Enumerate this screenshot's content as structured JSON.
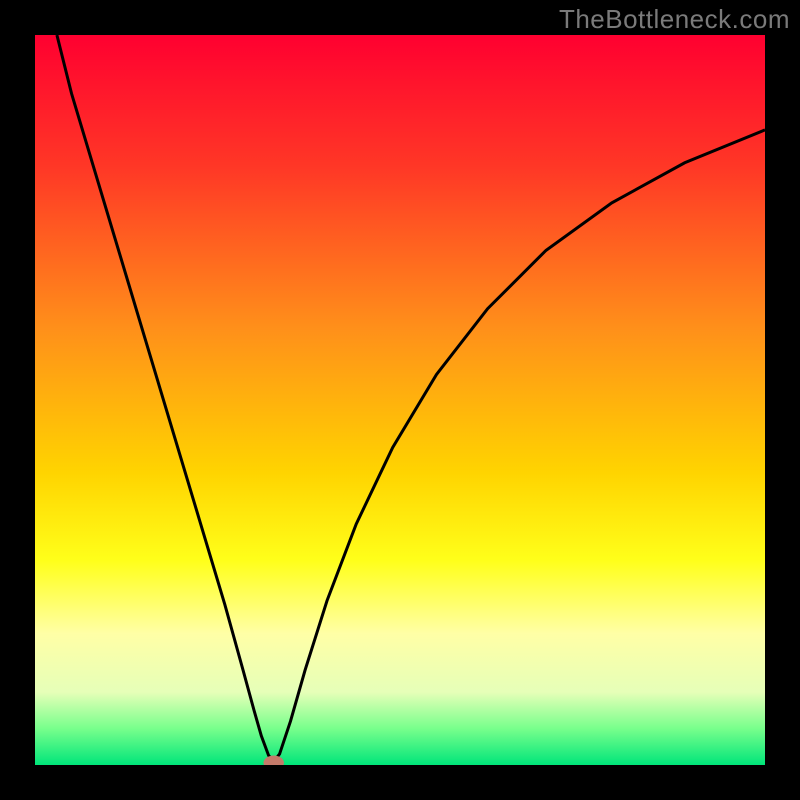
{
  "watermark": "TheBottleneck.com",
  "chart_data": {
    "type": "line",
    "title": "",
    "xlabel": "",
    "ylabel": "",
    "xlim": [
      0,
      1
    ],
    "ylim": [
      0,
      1
    ],
    "background_gradient": {
      "stops": [
        {
          "offset": 0.0,
          "color": "#ff0030"
        },
        {
          "offset": 0.18,
          "color": "#ff3726"
        },
        {
          "offset": 0.4,
          "color": "#ff8f1a"
        },
        {
          "offset": 0.6,
          "color": "#ffd400"
        },
        {
          "offset": 0.72,
          "color": "#ffff1a"
        },
        {
          "offset": 0.82,
          "color": "#ffffa6"
        },
        {
          "offset": 0.9,
          "color": "#e6ffb8"
        },
        {
          "offset": 0.95,
          "color": "#78ff8c"
        },
        {
          "offset": 1.0,
          "color": "#00e57a"
        }
      ]
    },
    "series": [
      {
        "name": "bottleneck-curve",
        "color": "#000000",
        "data": [
          {
            "x": 0.03,
            "y": 1.0
          },
          {
            "x": 0.05,
            "y": 0.92
          },
          {
            "x": 0.08,
            "y": 0.82
          },
          {
            "x": 0.11,
            "y": 0.72
          },
          {
            "x": 0.14,
            "y": 0.62
          },
          {
            "x": 0.17,
            "y": 0.52
          },
          {
            "x": 0.2,
            "y": 0.42
          },
          {
            "x": 0.23,
            "y": 0.32
          },
          {
            "x": 0.26,
            "y": 0.22
          },
          {
            "x": 0.285,
            "y": 0.13
          },
          {
            "x": 0.3,
            "y": 0.075
          },
          {
            "x": 0.31,
            "y": 0.04
          },
          {
            "x": 0.32,
            "y": 0.013
          },
          {
            "x": 0.327,
            "y": 0.005
          },
          {
            "x": 0.335,
            "y": 0.015
          },
          {
            "x": 0.35,
            "y": 0.06
          },
          {
            "x": 0.37,
            "y": 0.13
          },
          {
            "x": 0.4,
            "y": 0.225
          },
          {
            "x": 0.44,
            "y": 0.33
          },
          {
            "x": 0.49,
            "y": 0.435
          },
          {
            "x": 0.55,
            "y": 0.535
          },
          {
            "x": 0.62,
            "y": 0.625
          },
          {
            "x": 0.7,
            "y": 0.705
          },
          {
            "x": 0.79,
            "y": 0.77
          },
          {
            "x": 0.89,
            "y": 0.825
          },
          {
            "x": 1.0,
            "y": 0.87
          }
        ]
      }
    ],
    "marker": {
      "name": "bottleneck-point",
      "x": 0.327,
      "y": 0.003,
      "rx": 0.014,
      "ry": 0.01,
      "color": "#c47a6a"
    }
  }
}
